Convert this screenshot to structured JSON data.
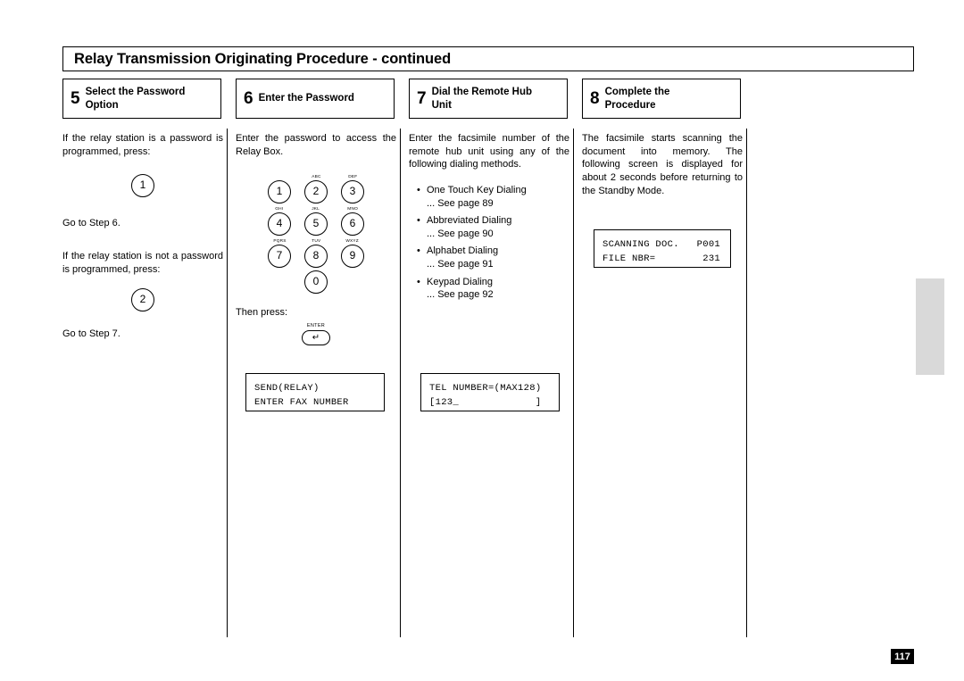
{
  "page": {
    "title": "Relay Transmission Originating Procedure - continued",
    "page_number": "117"
  },
  "steps": [
    {
      "number": "5",
      "label_line1": "Select the Password",
      "label_line2": "Option"
    },
    {
      "number": "6",
      "label_line1": "Enter the Password",
      "label_line2": ""
    },
    {
      "number": "7",
      "label_line1": "Dial the Remote Hub",
      "label_line2": "Unit"
    },
    {
      "number": "8",
      "label_line1": "Complete the",
      "label_line2": "Procedure"
    }
  ],
  "col5": {
    "para1": "If the relay station is a password is programmed, press:",
    "key1": "1",
    "para2": "Go to Step 6.",
    "para3": "If the relay station is not a password is programmed, press:",
    "key2": "2",
    "para4": "Go to Step 7."
  },
  "col6": {
    "para1": "Enter the password to access the Relay Box.",
    "keypad": [
      [
        {
          "digit": "1",
          "alpha": ""
        },
        {
          "digit": "2",
          "alpha": "ABC"
        },
        {
          "digit": "3",
          "alpha": "DEF"
        }
      ],
      [
        {
          "digit": "4",
          "alpha": "GHI"
        },
        {
          "digit": "5",
          "alpha": "JKL"
        },
        {
          "digit": "6",
          "alpha": "MNO"
        }
      ],
      [
        {
          "digit": "7",
          "alpha": "PQRS"
        },
        {
          "digit": "8",
          "alpha": "TUV"
        },
        {
          "digit": "9",
          "alpha": "WXYZ"
        }
      ]
    ],
    "keypad_zero": "0",
    "then_press": "Then press:",
    "enter_label": "ENTER",
    "enter_glyph": "↵",
    "lcd": "SEND(RELAY)\nENTER FAX NUMBER"
  },
  "col7": {
    "para1": "Enter the facsimile number of the remote hub unit using any of the following dialing methods.",
    "bullets": [
      {
        "title": "One Touch Key Dialing",
        "see": "... See page 89"
      },
      {
        "title": "Abbreviated Dialing",
        "see": "... See page 90"
      },
      {
        "title": "Alphabet Dialing",
        "see": "... See page 91"
      },
      {
        "title": "Keypad Dialing",
        "see": "... See page 92"
      }
    ],
    "lcd": "TEL NUMBER=(MAX128)\n[123_             ]"
  },
  "col8": {
    "para1": "The facsimile starts scanning the document into memory. The following screen is displayed for about 2 seconds before returning to the Standby Mode.",
    "lcd": "SCANNING DOC.   P001\nFILE NBR=        231"
  }
}
